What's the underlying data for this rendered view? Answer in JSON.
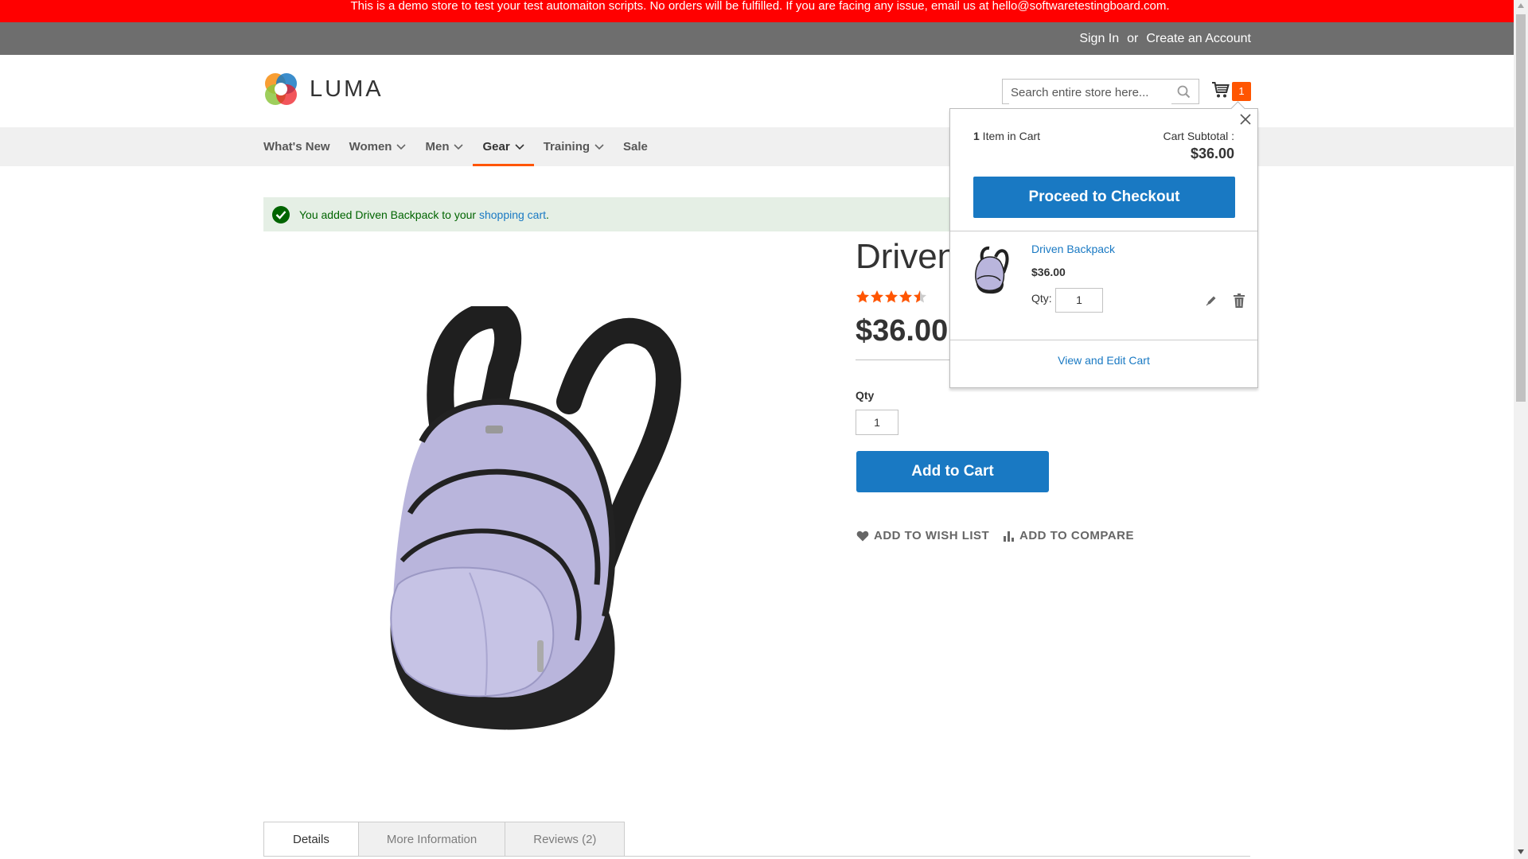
{
  "banner": {
    "text": "This is a demo store to test your test automaiton scripts. No orders will be fulfilled. If you are facing any issue, email us at hello@softwaretestingboard.com."
  },
  "header": {
    "sign_in": "Sign In",
    "or": "or",
    "create_account": "Create an Account",
    "logo_text": "LUMA",
    "search_placeholder": "Search entire store here...",
    "cart_count": "1"
  },
  "nav": {
    "items": [
      {
        "label": "What's New",
        "has_dropdown": false
      },
      {
        "label": "Women",
        "has_dropdown": true
      },
      {
        "label": "Men",
        "has_dropdown": true
      },
      {
        "label": "Gear",
        "has_dropdown": true,
        "active": true
      },
      {
        "label": "Training",
        "has_dropdown": true
      },
      {
        "label": "Sale",
        "has_dropdown": false
      }
    ]
  },
  "message": {
    "prefix": "You added Driven Backpack to your ",
    "link": "shopping cart",
    "suffix": "."
  },
  "product": {
    "title": "Driven",
    "rating_stars": 4.5,
    "price": "$36.00",
    "qty_label": "Qty",
    "qty_value": "1",
    "add_to_cart": "Add to Cart",
    "add_to_wishlist": "ADD TO WISH LIST",
    "add_to_compare": "ADD TO COMPARE"
  },
  "tabs": [
    {
      "label": "Details",
      "active": true
    },
    {
      "label": "More Information",
      "active": false
    },
    {
      "label": "Reviews (2)",
      "active": false
    }
  ],
  "minicart": {
    "count_num": "1",
    "count_text": " Item in Cart",
    "subtotal_label": "Cart Subtotal :",
    "subtotal_value": "$36.00",
    "checkout_label": "Proceed to Checkout",
    "item_name": "Driven Backpack",
    "item_price": "$36.00",
    "qty_label": "Qty:",
    "qty_value": "1",
    "view_edit": "View and Edit Cart"
  },
  "colors": {
    "banner": "#ff0000",
    "header_bar": "#6e6e6e",
    "primary_button": "#1979c3",
    "accent": "#ff5501",
    "success_bg": "#e5efe5",
    "success_text": "#006400"
  }
}
